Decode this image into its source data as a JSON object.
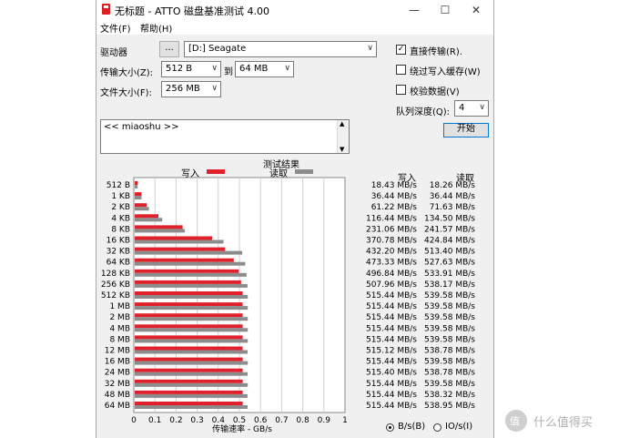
{
  "window": {
    "title": "无标题 - ATTO 磁盘基准测试 4.00",
    "minimize_glyph": "—",
    "maximize_glyph": "☐",
    "close_glyph": "✕"
  },
  "menu": {
    "items": [
      "文件(F)",
      "帮助(H)"
    ]
  },
  "settings": {
    "drive_label": "驱动器",
    "browse_label": "...",
    "drive_value": "[D:] Seagate",
    "transfer_size_label": "传输大小(Z):",
    "transfer_from": "512 B",
    "transfer_to_label": "到",
    "transfer_to": "64 MB",
    "file_size_label": "文件大小(F):",
    "file_size": "256 MB",
    "direct_io_label": "直接传输(R).",
    "direct_io_checked": true,
    "bypass_cache_label": "绕过写入缓存(W)",
    "bypass_cache_checked": false,
    "verify_label": "校验数据(V)",
    "verify_checked": false,
    "queue_depth_label": "队列深度(Q):",
    "queue_depth": "4",
    "start_label": "开始",
    "description": "<< miaoshu >>"
  },
  "results": {
    "title": "测试结果",
    "legend_write": "写入",
    "legend_read": "读取",
    "col_write": "写入",
    "col_read": "读取",
    "radio_bytes": "B/s(B)",
    "radio_io": "IO/s(I)",
    "radio_bytes_selected": true
  },
  "chart_data": {
    "type": "bar",
    "orientation": "horizontal",
    "xlabel": "传输速率 - GB/s",
    "xlim": [
      0,
      1
    ],
    "xticks": [
      "0",
      "0.1",
      "0.2",
      "0.3",
      "0.4",
      "0.5",
      "0.6",
      "0.7",
      "0.8",
      "0.9",
      "1"
    ],
    "categories": [
      "512 B",
      "1 KB",
      "2 KB",
      "4 KB",
      "8 KB",
      "16 KB",
      "32 KB",
      "64 KB",
      "128 KB",
      "256 KB",
      "512 KB",
      "1 MB",
      "2 MB",
      "4 MB",
      "8 MB",
      "12 MB",
      "16 MB",
      "24 MB",
      "32 MB",
      "48 MB",
      "64 MB"
    ],
    "series": [
      {
        "name": "写入",
        "color": "#e0202a",
        "values": [
          0.01843,
          0.03644,
          0.06122,
          0.11644,
          0.23106,
          0.37078,
          0.4322,
          0.47333,
          0.49686,
          0.50796,
          0.51544,
          0.51544,
          0.51544,
          0.51544,
          0.51544,
          0.51512,
          0.51544,
          0.5154,
          0.51544,
          0.51544,
          0.51544
        ],
        "labels": [
          "18.43 MB/s",
          "36.44 MB/s",
          "61.22 MB/s",
          "116.44 MB/s",
          "231.06 MB/s",
          "370.78 MB/s",
          "432.20 MB/s",
          "473.33 MB/s",
          "496.84 MB/s",
          "507.96 MB/s",
          "515.44 MB/s",
          "515.44 MB/s",
          "515.44 MB/s",
          "515.44 MB/s",
          "515.44 MB/s",
          "515.12 MB/s",
          "515.44 MB/s",
          "515.40 MB/s",
          "515.44 MB/s",
          "515.44 MB/s",
          "515.44 MB/s"
        ]
      },
      {
        "name": "读取",
        "color": "#8c8c8c",
        "values": [
          0.01826,
          0.03644,
          0.07163,
          0.1345,
          0.24157,
          0.42484,
          0.5134,
          0.52763,
          0.53391,
          0.53817,
          0.53958,
          0.53958,
          0.53958,
          0.53958,
          0.53958,
          0.53878,
          0.53958,
          0.53878,
          0.53958,
          0.53832,
          0.53895
        ],
        "labels": [
          "18.26 MB/s",
          "36.44 MB/s",
          "71.63 MB/s",
          "134.50 MB/s",
          "241.57 MB/s",
          "424.84 MB/s",
          "513.40 MB/s",
          "527.63 MB/s",
          "533.91 MB/s",
          "538.17 MB/s",
          "539.58 MB/s",
          "539.58 MB/s",
          "539.58 MB/s",
          "539.58 MB/s",
          "539.58 MB/s",
          "538.78 MB/s",
          "539.58 MB/s",
          "538.78 MB/s",
          "539.58 MB/s",
          "538.32 MB/s",
          "538.95 MB/s"
        ]
      }
    ]
  },
  "watermark": {
    "text": "什么值得买"
  }
}
